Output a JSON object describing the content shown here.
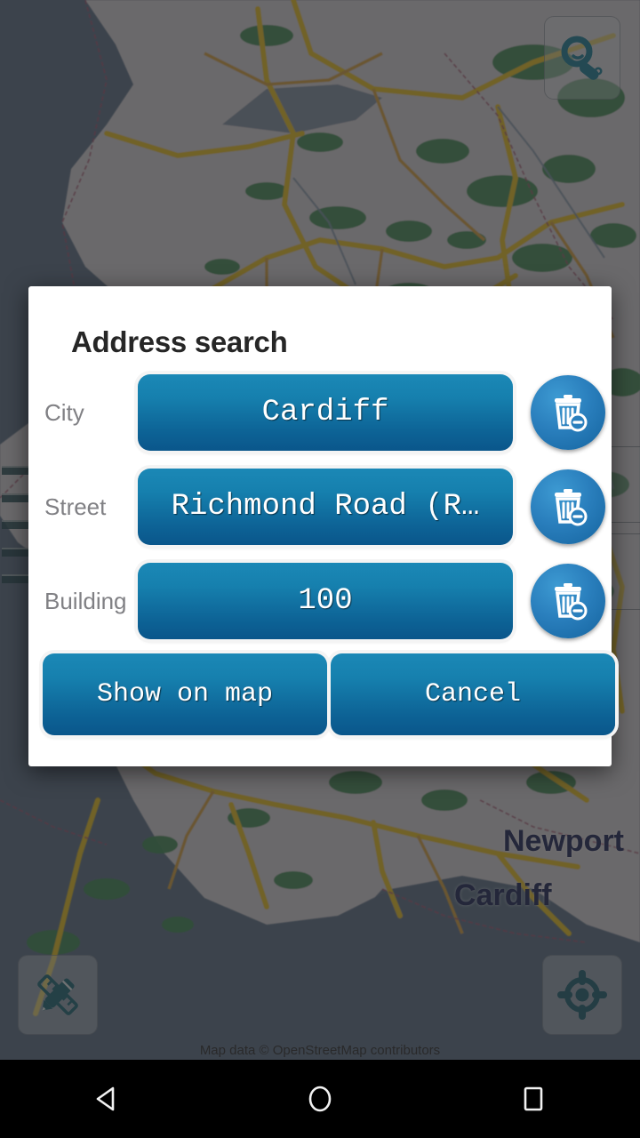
{
  "app": {
    "map_attribution": "Map data © OpenStreetMap contributors"
  },
  "map": {
    "labels": [
      {
        "name": "Newport",
        "text": "Newport"
      },
      {
        "name": "Cardiff",
        "text": "Cardiff"
      }
    ],
    "controls": [
      {
        "id": "search",
        "icon": "magnifier-icon",
        "tooltip": "Search"
      },
      {
        "id": "measure",
        "icon": "ruler-pencil-icon",
        "tooltip": "Measure"
      },
      {
        "id": "gps",
        "icon": "gps-crosshair-icon",
        "tooltip": "My location"
      }
    ],
    "colors": {
      "water": "#5d7085",
      "land": "#d6d2d4",
      "forest": "#3f8a52",
      "motorway": "#e8c020",
      "trunk": "#d9a23a",
      "boundary": "#a3536d",
      "label": "#1e2555"
    }
  },
  "dialog": {
    "title": "Address search",
    "fields": [
      {
        "label": "City",
        "value": "Cardiff",
        "clear_icon": "trash-minus-icon"
      },
      {
        "label": "Street",
        "value": "Richmond Road (R…",
        "clear_icon": "trash-minus-icon"
      },
      {
        "label": "Building",
        "value": "100",
        "clear_icon": "trash-minus-icon"
      }
    ],
    "actions": {
      "primary": "Show on map",
      "secondary": "Cancel"
    },
    "colors": {
      "button_top": "#1b88b6",
      "button_bottom": "#0a568b",
      "clear_button": "#2a7fbd",
      "label": "#808084",
      "title": "#262626"
    }
  },
  "navbar": {
    "buttons": [
      {
        "name": "back",
        "icon": "triangle-back-icon"
      },
      {
        "name": "home",
        "icon": "circle-home-icon"
      },
      {
        "name": "recents",
        "icon": "square-recents-icon"
      }
    ]
  }
}
